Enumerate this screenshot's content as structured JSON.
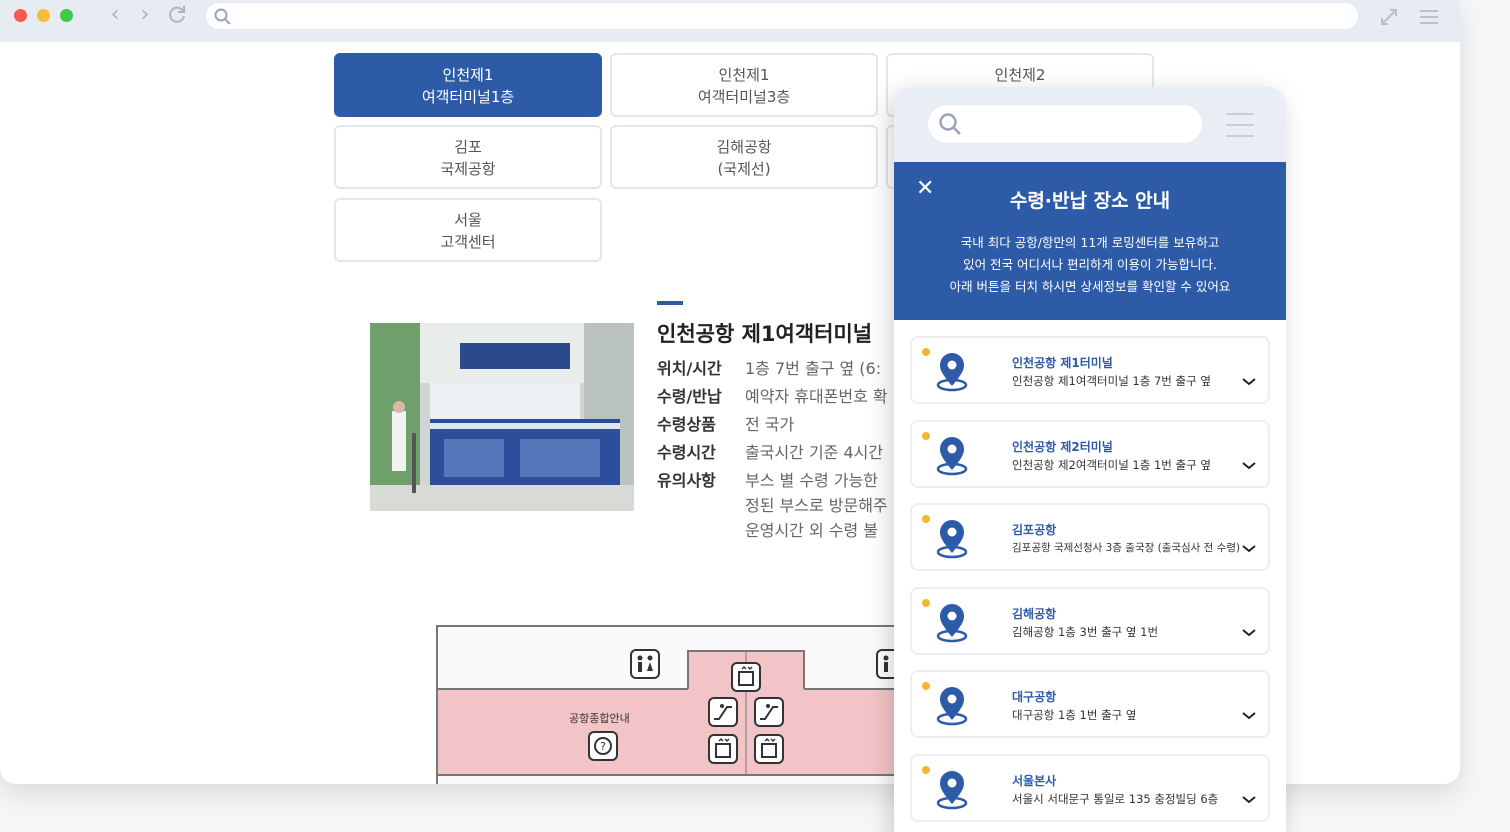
{
  "tabs": [
    {
      "line1": "인천제1",
      "line2": "여객터미널1층",
      "active": true
    },
    {
      "line1": "인천제1",
      "line2": "여객터미널3층",
      "active": false
    },
    {
      "line1": "인천제2",
      "line2": "",
      "active": false
    },
    {
      "line1": "김포",
      "line2": "국제공항",
      "active": false
    },
    {
      "line1": "김해공항",
      "line2": "(국제선)",
      "active": false
    },
    {
      "line1": "서울",
      "line2": "고객센터",
      "active": false
    }
  ],
  "info": {
    "title": "인천공항 제1여객터미널",
    "rows": [
      {
        "key": "위치/시간",
        "value": "1층 7번 출구 옆 (6:"
      },
      {
        "key": "수령/반납",
        "value": "예약자 휴대폰번호 확"
      },
      {
        "key": "수령상품",
        "value": "전 국가"
      },
      {
        "key": "수령시간",
        "value": "출국시간 기준 4시간"
      },
      {
        "key": "유의사항",
        "value": "부스 별 수령 가능한"
      }
    ],
    "notes": [
      "정된 부스로 방문해주",
      "운영시간 외 수령 불"
    ]
  },
  "map": {
    "label": "공항종합안내"
  },
  "panel": {
    "title": "수령·반납 장소 안내",
    "desc": [
      "국내 최다 공항/항만의 11개 로밍센터를 보유하고",
      "있어 전국 어디서나 편리하게 이용이 가능합니다.",
      "아래 버튼을 터치 하시면 상세정보를 확인할 수 있어요"
    ],
    "locations": [
      {
        "name": "인천공항 제1터미널",
        "address": "인천공항 제1여객터미널 1층 7번 출구 옆"
      },
      {
        "name": "인천공항 제2터미널",
        "address": "인천공항 제2여객터미널 1층 1번 출구 옆"
      },
      {
        "name": "김포공항",
        "address": "김포공항 국제선청사 3층 출국장 (출국심사 전 수령)"
      },
      {
        "name": "김해공항",
        "address": "김해공항 1층 3번 출구 옆 1번"
      },
      {
        "name": "대구공항",
        "address": "대구공항 1층 1번 출구 옆"
      },
      {
        "name": "서울본사",
        "address": "서울시 서대문구 통일로 135 충정빌딩 6층"
      }
    ]
  },
  "colors": {
    "primary": "#2d5ba8",
    "accent_dot": "#f5b52e",
    "map_pink": "#f3c4c7"
  }
}
